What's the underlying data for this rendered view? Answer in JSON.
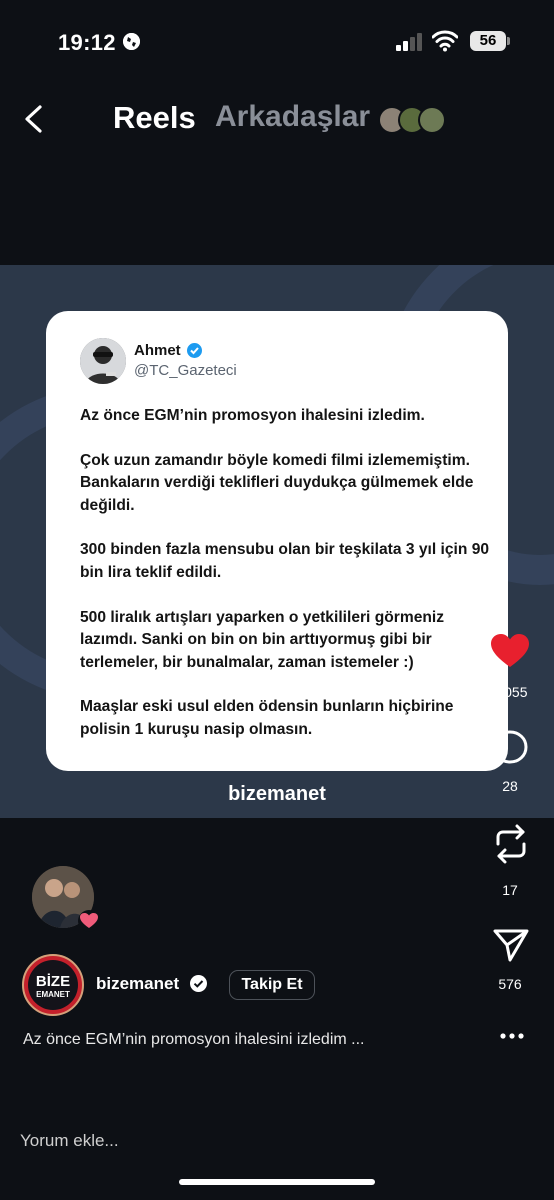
{
  "status_bar": {
    "time": "19:12",
    "battery": "56"
  },
  "header": {
    "title": "Reels",
    "friends_label": "Arkadaşlar"
  },
  "post": {
    "tweet": {
      "name": "Ahmet",
      "handle": "@TC_Gazeteci",
      "paragraphs": [
        "Az önce EGM’nin promosyon ihalesini izledim.",
        "Çok uzun zamandır böyle komedi filmi izlememiştim. Bankaların verdiği teklifleri duydukça gülmemek elde değildi.",
        "300 binden fazla mensubu olan bir teşkilata 3 yıl için 90 bin lira teklif edildi.",
        "500 liralık artışları yaparken o yetkilileri görmeniz lazımdı. Sanki on bin on bin arttıyormuş gibi bir terlemeler, bir bunalmalar, zaman istemeler :)",
        "Maaşlar eski usul elden ödensin bunların hiçbirine polisin 1 kuruşu nasip olmasın."
      ]
    },
    "brand": "bizemanet"
  },
  "actions": {
    "likes": "1.055",
    "comments": "28",
    "reposts": "17",
    "shares": "576"
  },
  "author": {
    "username": "bizemanet",
    "follow_label": "Takip Et",
    "logo_top": "BİZE",
    "logo_bottom": "EMANET"
  },
  "caption": "Az önce EGM’nin promosyon ihalesini izledim ...",
  "comment_placeholder": "Yorum ekle...",
  "colors": {
    "like": "#e8202e",
    "verified": "#1d9bf0",
    "post_bg": "#2c3849"
  }
}
